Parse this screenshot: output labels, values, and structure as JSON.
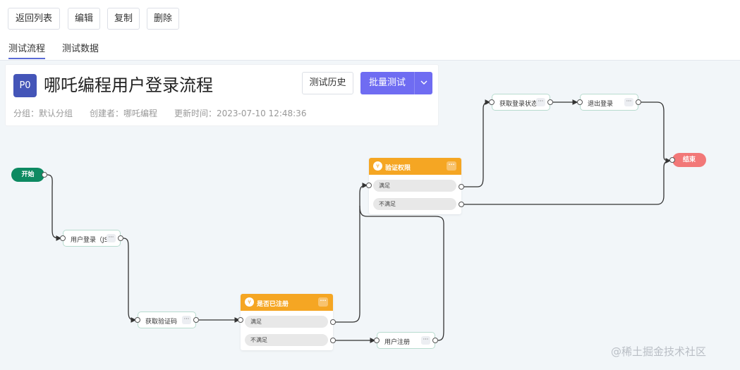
{
  "toolbar": {
    "back": "返回列表",
    "edit": "编辑",
    "copy": "复制",
    "delete": "删除"
  },
  "tabs": {
    "flow": "测试流程",
    "data": "测试数据"
  },
  "header": {
    "avatar": "P0",
    "title": "哪吒编程用户登录流程",
    "history_button": "测试历史",
    "batch_button": "批量测试",
    "group": "分组：默认分组",
    "creator": "创建者：哪吒编程",
    "updated": "更新时间：2023-07-10 12:48:36"
  },
  "flow": {
    "start": "开始",
    "end": "结束",
    "user_login": "用户登录（JS...",
    "get_captcha": "获取验证码",
    "get_login_status": "获取登录状态",
    "logout": "退出登录",
    "user_register": "用户注册",
    "more": "···",
    "check_registered": {
      "name": "是否已注册",
      "yes": "满足",
      "no": "不满足"
    },
    "check_permission": {
      "name": "验证权限",
      "yes": "满足",
      "no": "不满足"
    },
    "colors": {
      "start": "#0e8a62",
      "end": "#f27878",
      "condition": "#f5a623",
      "node_border": "#b8dccf",
      "primary": "#6f6cf2"
    }
  },
  "watermark": "@稀土掘金技术社区"
}
